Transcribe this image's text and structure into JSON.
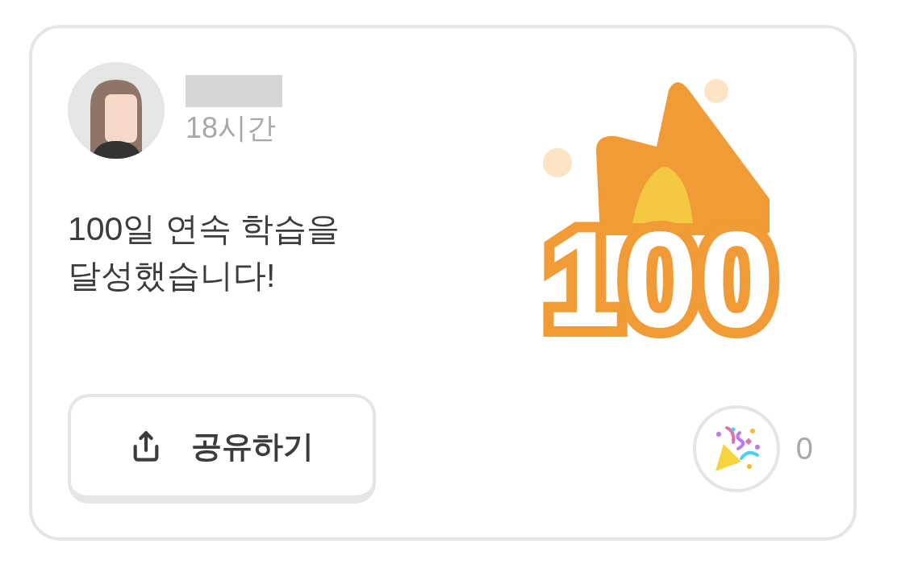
{
  "post": {
    "time": "18시간",
    "message": "100일 연속 학습을\n달성했습니다!"
  },
  "badge": {
    "number": "100"
  },
  "share_button": {
    "label": "공유하기"
  },
  "reaction": {
    "count": "0"
  }
}
